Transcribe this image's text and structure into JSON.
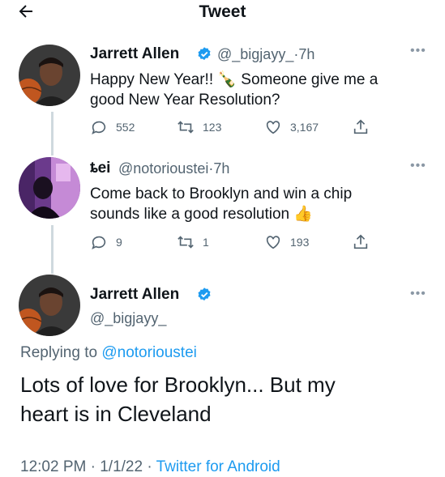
{
  "header": {
    "title": "Tweet"
  },
  "tweets": [
    {
      "name": "Jarrett Allen",
      "handle": "@_bigjayy_",
      "separator": "·",
      "time": "7h",
      "text_line1": "Happy New Year!! 🍾 Someone give me a",
      "text_line2": "good New Year Resolution?",
      "replies": "552",
      "retweets": "123",
      "likes": "3,167"
    },
    {
      "name": "ȶei",
      "handle": "@notorioustei",
      "separator": "·",
      "time": "7h",
      "text_line1": "Come back to Brooklyn and win a chip",
      "text_line2": "sounds like a good resolution 👍",
      "replies": "9",
      "retweets": "1",
      "likes": "193"
    }
  ],
  "main_tweet": {
    "name": "Jarrett Allen",
    "handle": "@_bigjayy_",
    "replying_prefix": "Replying to",
    "replying_handle": "@notorioustei",
    "text_line1": "Lots of love for Brooklyn... But my",
    "text_line2": "heart is in Cleveland",
    "time": "12:02 PM",
    "sep1": "·",
    "date": "1/1/22",
    "sep2": "·",
    "source": "Twitter for Android"
  },
  "icons": {
    "back": "back-arrow-icon",
    "verified": "verified-badge-icon",
    "reply": "reply-icon",
    "retweet": "retweet-icon",
    "like": "heart-icon",
    "share": "share-icon",
    "more": "more-options-icon"
  },
  "colors": {
    "text": "#0f1419",
    "secondary": "#536471",
    "link": "#1d9bf0",
    "verified": "#1d9bf0"
  }
}
